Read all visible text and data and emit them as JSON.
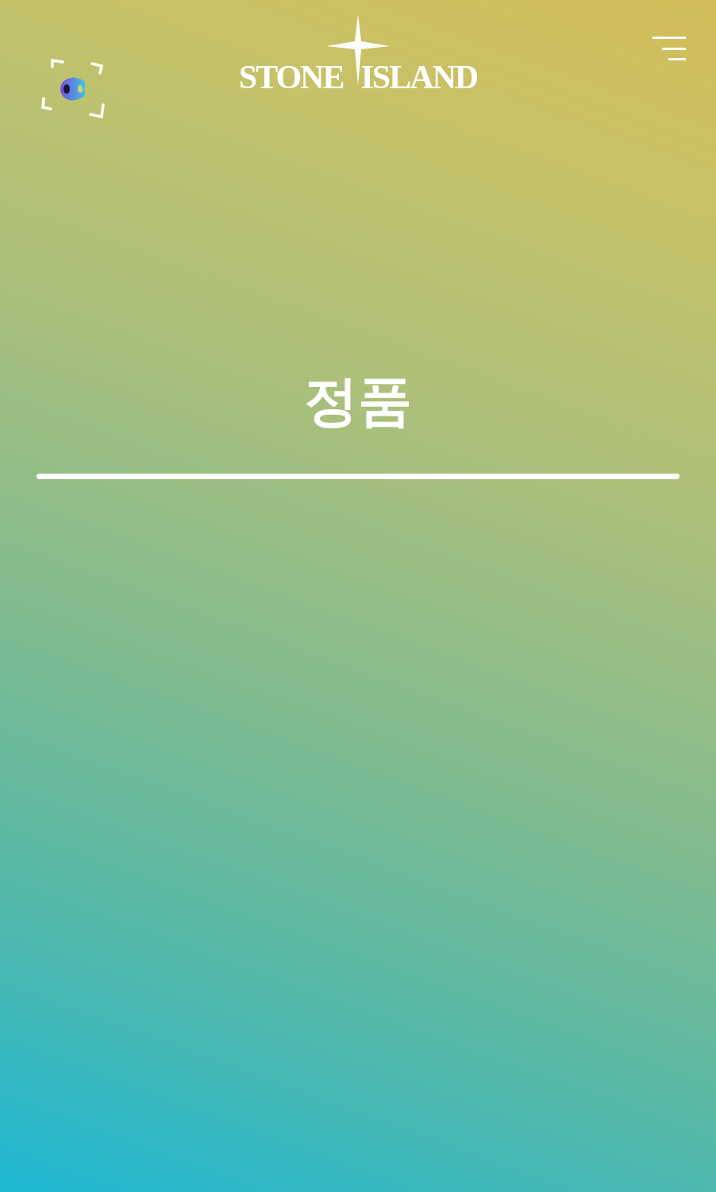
{
  "header": {
    "logo_words": [
      "STONE",
      "ISLAND"
    ]
  },
  "title": "정품"
}
